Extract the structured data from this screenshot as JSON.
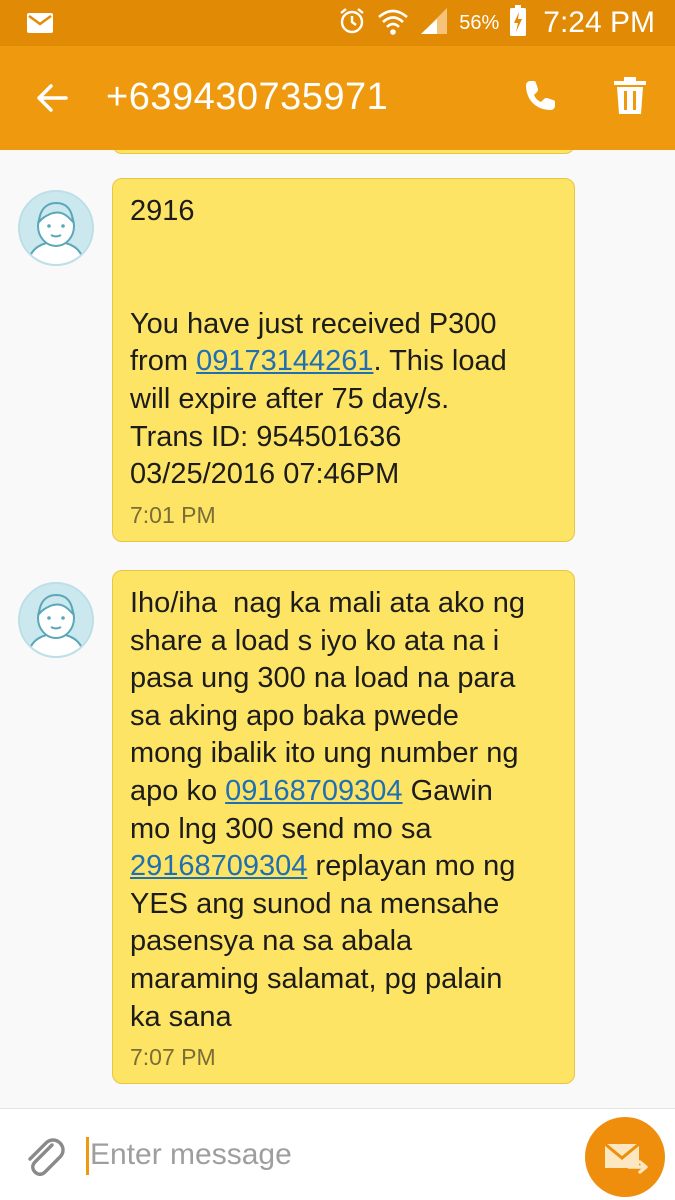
{
  "status_bar": {
    "battery_percent": "56%",
    "time": "7:24 PM",
    "icons": [
      "message-notification-icon",
      "alarm-icon",
      "wifi-icon",
      "signal-icon",
      "battery-charging-icon"
    ]
  },
  "header": {
    "title": "+639430735971",
    "icons": [
      "back-arrow-icon",
      "phone-call-icon",
      "trash-icon"
    ]
  },
  "messages": [
    {
      "line1": "2916",
      "body_before_link": "You have just received P300\nfrom ",
      "link1": "09173144261",
      "body_after_link": ". This load\nwill expire after 75 day/s.\nTrans ID: 954501636\n03/25/2016 07:46PM",
      "time": "7:01 PM"
    },
    {
      "body_part1": "Iho/iha  nag ka mali ata ako ng\nshare a load s iyo ko ata na i\npasa ung 300 na load na para\nsa aking apo baka pwede\nmong ibalik ito ung number ng\napo ko ",
      "link1": "09168709304",
      "body_part2": " Gawin\nmo lng 300 send mo sa\n",
      "link2": "29168709304",
      "body_part3": " replayan mo ng\nYES ang sunod na mensahe\npasensya na sa abala\nmaraming salamat, pg palain\nka sana",
      "time": "7:07 PM"
    }
  ],
  "composer": {
    "placeholder": "Enter message",
    "icons": [
      "paperclip-icon",
      "send-message-icon"
    ]
  },
  "colors": {
    "status_bar": "#e08a06",
    "app_bar": "#ef9a0e",
    "bubble": "#fde465",
    "link": "#1f6fb3",
    "send_button": "#ef8e0d"
  }
}
